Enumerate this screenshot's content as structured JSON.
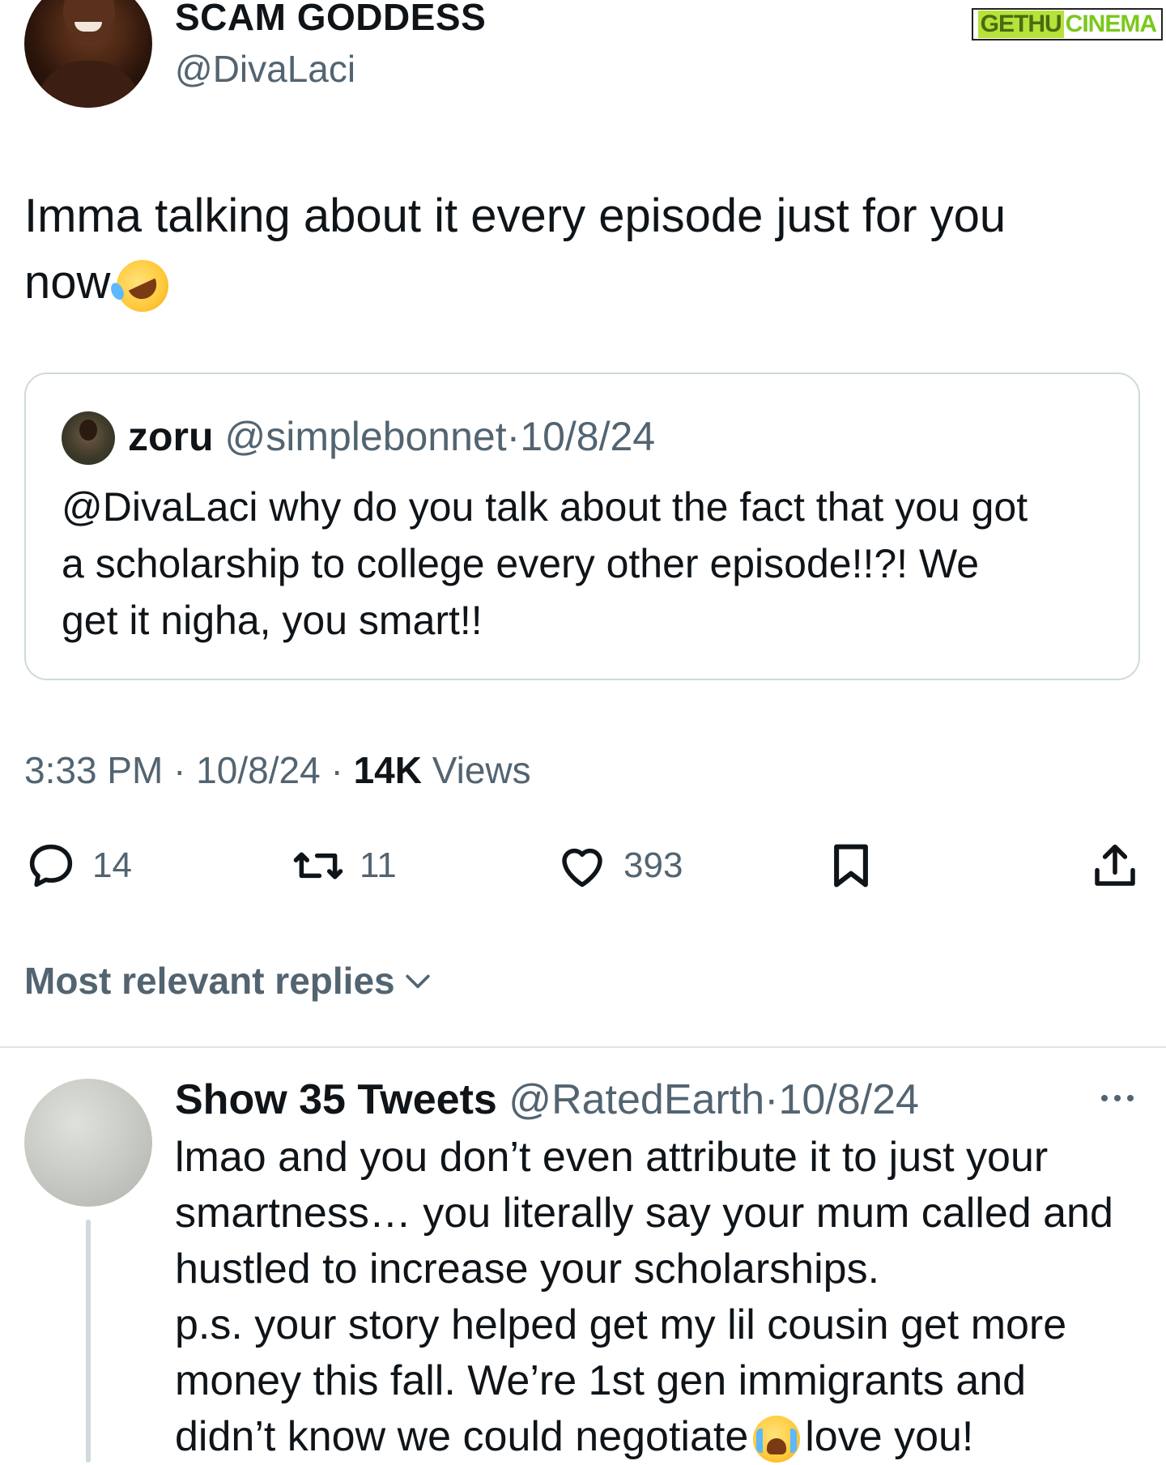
{
  "author": {
    "display_name": "SCAM GODDESS",
    "handle": "@DivaLaci"
  },
  "watermark": {
    "part1": "GETHU",
    "part2": "CINEMA"
  },
  "tweet": {
    "text_line1": "Imma talking about it every episode just for you",
    "text_line2": "now",
    "emoji": "rolling-on-floor-laughing-emoji"
  },
  "quoted_tweet": {
    "name": "zoru",
    "handle": "@simplebonnet",
    "separator": "·",
    "date": "10/8/24",
    "lines": [
      "@DivaLaci why do you talk about the fact that you got",
      "a scholarship to college every other episode!!?! We",
      "get it nigha, you smart!!"
    ]
  },
  "meta": {
    "time": "3:33 PM",
    "separator": "·",
    "date": "10/8/24",
    "views_count": "14K",
    "views_label": "Views"
  },
  "actions": {
    "reply_count": "14",
    "retweet_count": "11",
    "like_count": "393"
  },
  "replies_sort": {
    "label": "Most relevant replies"
  },
  "reply": {
    "name": "Show 35 Tweets",
    "handle": "@RatedEarth",
    "separator": "·",
    "date": "10/8/24",
    "lines": [
      "lmao and you don’t even attribute it to just your",
      "smartness… you literally say your mum called and",
      "hustled to increase your scholarships.",
      "p.s. your story helped get my lil cousin get more",
      "money this fall. We’re 1st gen immigrants and"
    ],
    "last_line_before_emoji": "didn’t know we could negotiate",
    "last_line_after_emoji": "love you!",
    "emoji": "loudly-crying-face-emoji"
  },
  "colors": {
    "text": "#0f1419",
    "muted": "#536471",
    "border": "#cfd9de",
    "watermark_green": "#7bc81b"
  }
}
